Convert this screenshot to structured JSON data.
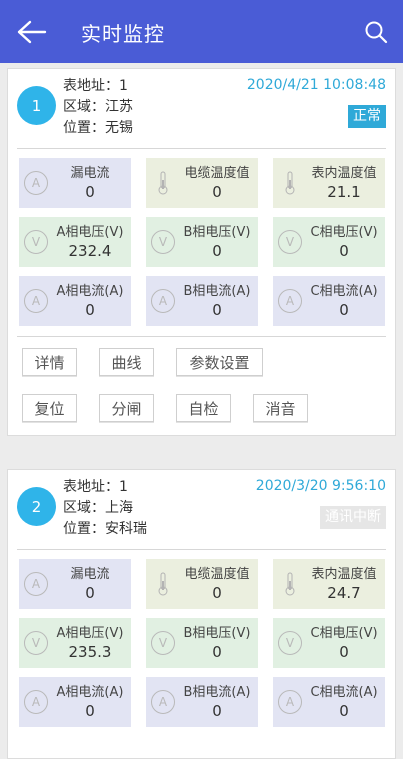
{
  "header": {
    "title": "实时监控"
  },
  "labels": {
    "address": "表地址：",
    "region": "区域：",
    "location": "位置："
  },
  "cards": [
    {
      "index": "1",
      "address": "1",
      "region": "江苏",
      "location": "无锡",
      "time": "2020/4/21 10:08:48",
      "status": "正常",
      "tiles": [
        {
          "icon": "A",
          "label": "漏电流",
          "value": "0"
        },
        {
          "icon": "thermometer",
          "label": "电缆温度值",
          "value": "0"
        },
        {
          "icon": "thermometer",
          "label": "表内温度值",
          "value": "21.1"
        },
        {
          "icon": "V",
          "label": "A相电压(V)",
          "value": "232.4"
        },
        {
          "icon": "V",
          "label": "B相电压(V)",
          "value": "0"
        },
        {
          "icon": "V",
          "label": "C相电压(V)",
          "value": "0"
        },
        {
          "icon": "A",
          "label": "A相电流(A)",
          "value": "0"
        },
        {
          "icon": "A",
          "label": "B相电流(A)",
          "value": "0"
        },
        {
          "icon": "A",
          "label": "C相电流(A)",
          "value": "0"
        }
      ],
      "buttons": [
        "详情",
        "曲线",
        "参数设置",
        "复位",
        "分闸",
        "自检",
        "消音"
      ]
    },
    {
      "index": "2",
      "address": "1",
      "region": "上海",
      "location": "安科瑞",
      "time": "2020/3/20 9:56:10",
      "status": "通讯中断",
      "tiles": [
        {
          "icon": "A",
          "label": "漏电流",
          "value": "0"
        },
        {
          "icon": "thermometer",
          "label": "电缆温度值",
          "value": "0"
        },
        {
          "icon": "thermometer",
          "label": "表内温度值",
          "value": "24.7"
        },
        {
          "icon": "V",
          "label": "A相电压(V)",
          "value": "235.3"
        },
        {
          "icon": "V",
          "label": "B相电压(V)",
          "value": "0"
        },
        {
          "icon": "V",
          "label": "C相电压(V)",
          "value": "0"
        },
        {
          "icon": "A",
          "label": "A相电流(A)",
          "value": "0"
        },
        {
          "icon": "A",
          "label": "B相电流(A)",
          "value": "0"
        },
        {
          "icon": "A",
          "label": "C相电流(A)",
          "value": "0"
        }
      ]
    }
  ],
  "colors": {
    "header": "#4a5cd6",
    "accent": "#2fa9d8",
    "tile_blue": "#e2e4f3",
    "tile_beige": "#ebefdf",
    "tile_green": "#e1f0e2"
  }
}
